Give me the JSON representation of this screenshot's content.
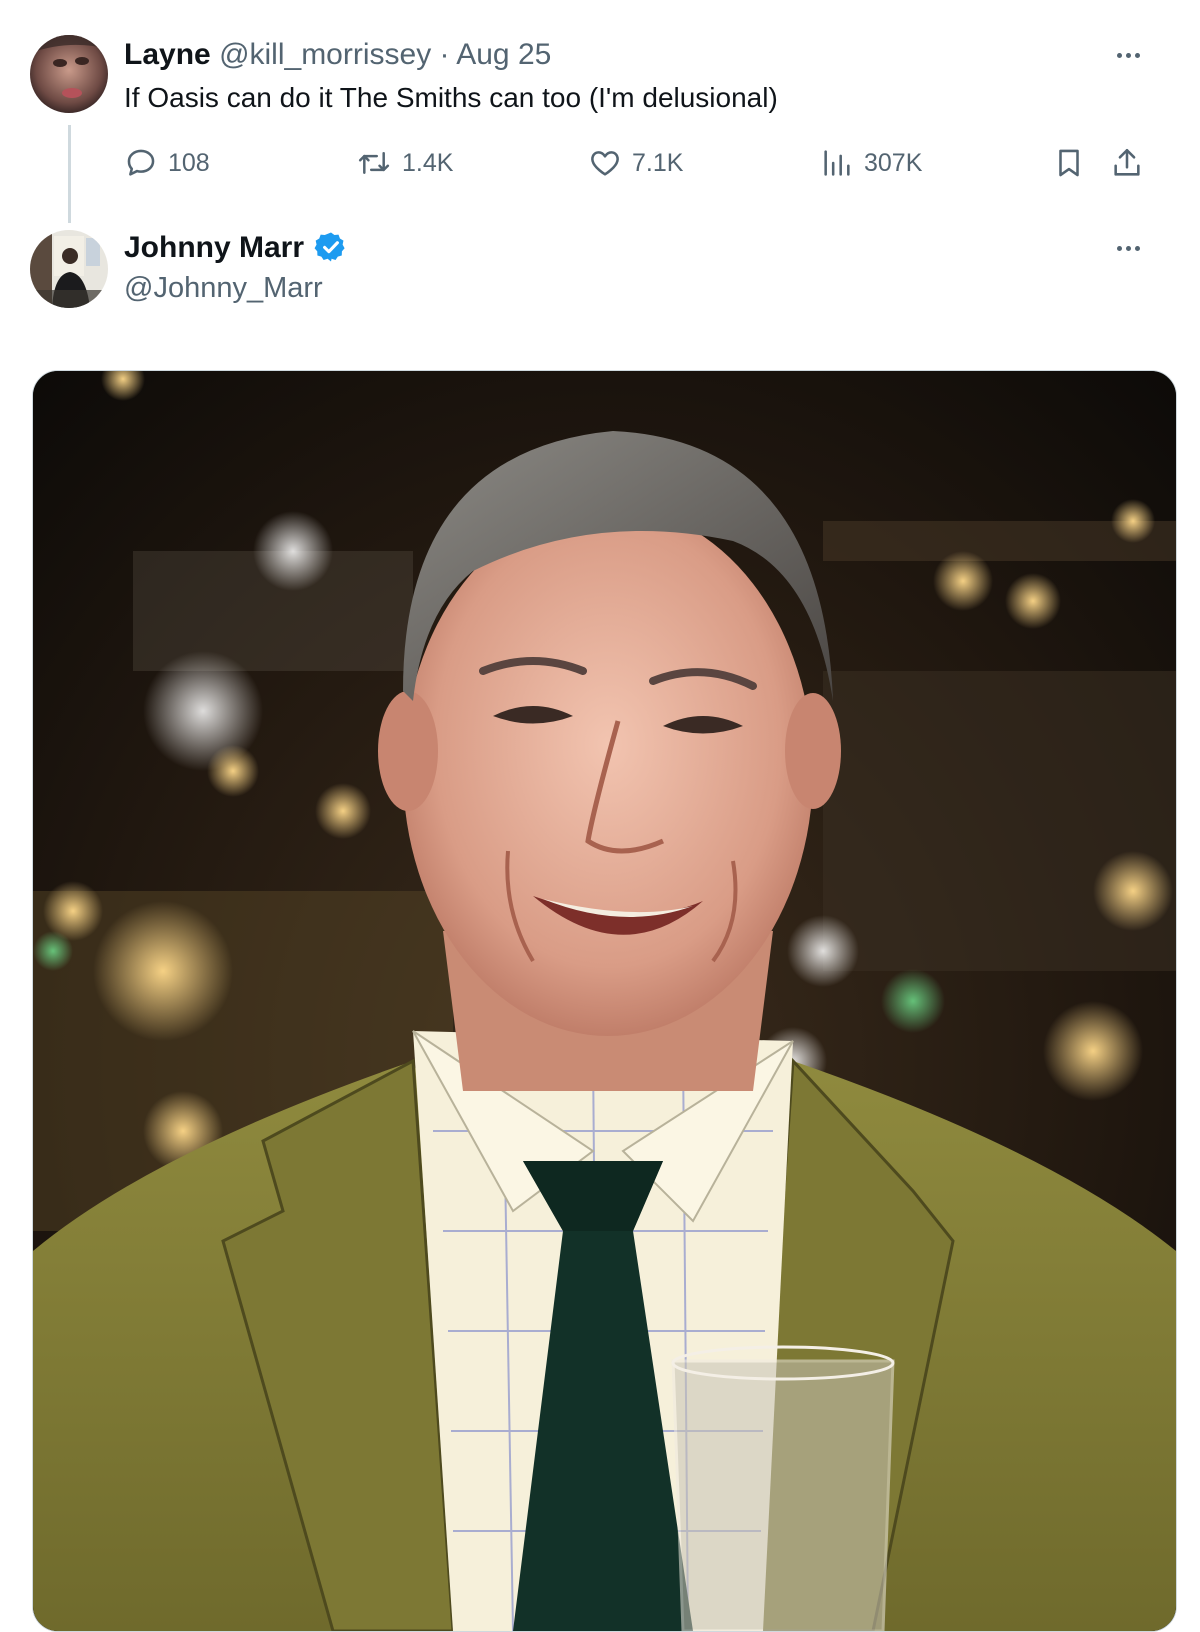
{
  "parent_tweet": {
    "display_name": "Layne",
    "handle": "@kill_morrissey",
    "separator": "·",
    "date": "Aug 25",
    "text": "If Oasis can do it The Smiths can too (I'm delusional)",
    "actions": {
      "reply_count": "108",
      "repost_count": "1.4K",
      "like_count": "7.1K",
      "views_count": "307K"
    }
  },
  "reply_tweet": {
    "display_name": "Johnny Marr",
    "handle": "@Johnny_Marr",
    "verified": true,
    "media_description": "photo"
  },
  "icons": {
    "reply": "speech-bubble-icon",
    "repost": "repost-arrows-icon",
    "like": "heart-icon",
    "views": "bar-chart-icon",
    "bookmark": "bookmark-icon",
    "share": "share-upload-icon",
    "more": "more-dots-icon",
    "verified": "verified-badge-icon"
  },
  "colors": {
    "text_primary": "#0f1419",
    "text_secondary": "#536471",
    "verified_blue": "#1d9bf0",
    "thread_line": "#cfd9de"
  }
}
